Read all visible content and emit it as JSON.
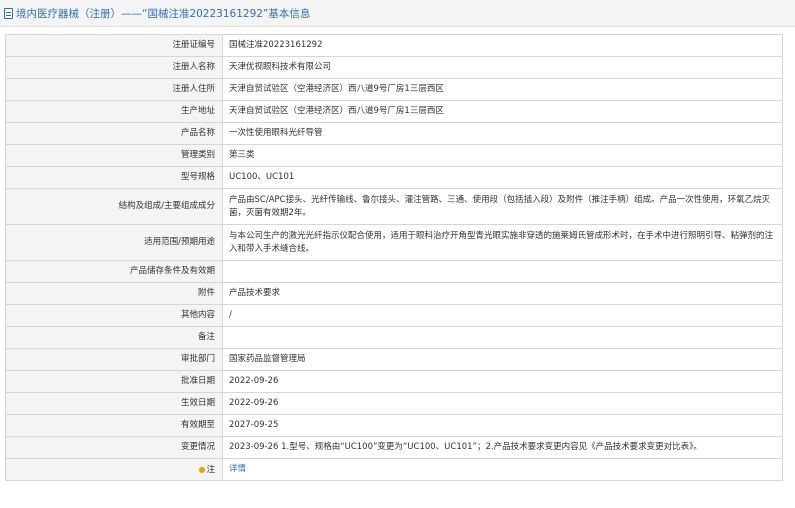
{
  "header": {
    "title": "境内医疗器械（注册）——“国械注准20223161292”基本信息"
  },
  "rows": [
    {
      "label": "注册证编号",
      "value": "国械注准20223161292"
    },
    {
      "label": "注册人名称",
      "value": "天津优视眼科技术有限公司"
    },
    {
      "label": "注册人住所",
      "value": "天津自贸试验区（空港经济区）西八道9号厂房1三层西区"
    },
    {
      "label": "生产地址",
      "value": "天津自贸试验区（空港经济区）西八道9号厂房1三层西区"
    },
    {
      "label": "产品名称",
      "value": "一次性使用眼科光纤导管"
    },
    {
      "label": "管理类别",
      "value": "第三类"
    },
    {
      "label": "型号规格",
      "value": "UC100、UC101"
    },
    {
      "label": "结构及组成/主要组成成分",
      "value": "产品由SC/APC接头、光纤传输线、鲁尔接头、灌注管路、三通、使用段（包括插入段）及附件（推注手柄）组成。产品一次性使用，环氧乙烷灭菌，灭菌有效期2年。"
    },
    {
      "label": "适用范围/预期用途",
      "value": "与本公司生产的激光光纤指示仪配合使用，适用于眼科治疗开角型青光眼实施非穿透的施莱姆氏管成形术时，在手术中进行照明引导、粘弹剂的注入和带入手术缝合线。"
    },
    {
      "label": "产品储存条件及有效期",
      "value": ""
    },
    {
      "label": "附件",
      "value": "产品技术要求"
    },
    {
      "label": "其他内容",
      "value": "/"
    },
    {
      "label": "备注",
      "value": ""
    },
    {
      "label": "审批部门",
      "value": "国家药品监督管理局"
    },
    {
      "label": "批准日期",
      "value": "2022-09-26"
    },
    {
      "label": "生效日期",
      "value": "2022-09-26"
    },
    {
      "label": "有效期至",
      "value": "2027-09-25"
    },
    {
      "label": "变更情况",
      "value": "2023-09-26 1.型号、规格由“UC100”变更为“UC100、UC101”；2.产品技术要求变更内容见《产品技术要求变更对比表》。"
    },
    {
      "label": "注",
      "value": "详情",
      "icon": "hint-icon"
    }
  ]
}
